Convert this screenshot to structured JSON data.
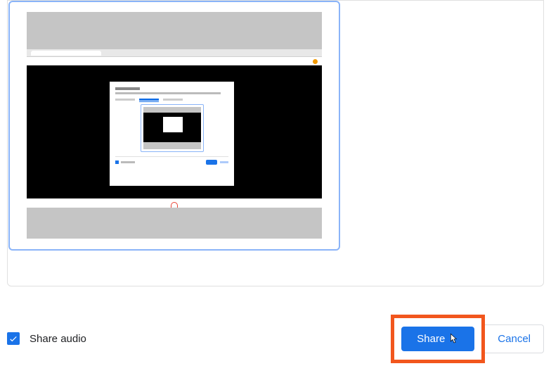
{
  "footer": {
    "share_audio_label": "Share audio",
    "share_audio_checked": true,
    "share_button_label": "Share",
    "cancel_button_label": "Cancel"
  },
  "highlight": {
    "color": "#f2561d"
  },
  "colors": {
    "primary": "#1a73e8",
    "selection_border": "#8ab4f8"
  }
}
